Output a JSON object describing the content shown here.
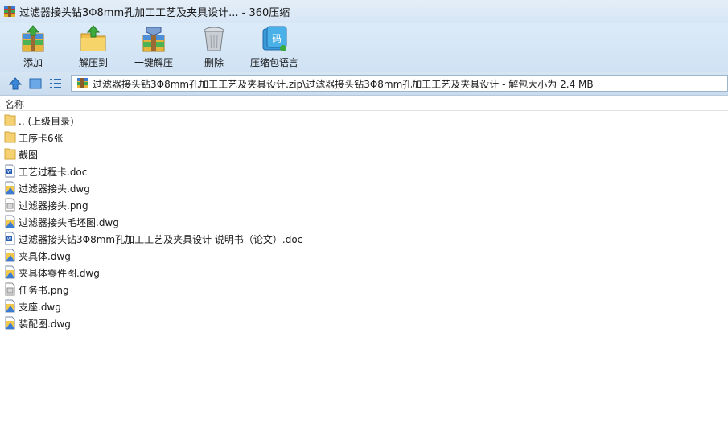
{
  "window": {
    "title": "过滤器接头钻3Φ8mm孔加工工艺及夹具设计... - 360压缩"
  },
  "toolbar": {
    "add": "添加",
    "extract_to": "解压到",
    "one_click_extract": "一键解压",
    "delete": "删除",
    "language": "压缩包语言"
  },
  "address": {
    "path": "过滤器接头钻3Φ8mm孔加工工艺及夹具设计.zip\\过滤器接头钻3Φ8mm孔加工工艺及夹具设计 - 解包大小为 2.4 MB"
  },
  "list": {
    "header": "名称",
    "items": [
      {
        "name": ".. (上级目录)",
        "type": "folder"
      },
      {
        "name": "工序卡6张",
        "type": "folder"
      },
      {
        "name": "截图",
        "type": "folder"
      },
      {
        "name": "工艺过程卡.doc",
        "type": "doc"
      },
      {
        "name": "过滤器接头.dwg",
        "type": "dwg"
      },
      {
        "name": "过滤器接头.png",
        "type": "png"
      },
      {
        "name": "过滤器接头毛坯图.dwg",
        "type": "dwg"
      },
      {
        "name": "过滤器接头钻3Φ8mm孔加工工艺及夹具设计 说明书（论文）.doc",
        "type": "doc"
      },
      {
        "name": "夹具体.dwg",
        "type": "dwg"
      },
      {
        "name": "夹具体零件图.dwg",
        "type": "dwg"
      },
      {
        "name": "任务书.png",
        "type": "png"
      },
      {
        "name": "支座.dwg",
        "type": "dwg"
      },
      {
        "name": "装配图.dwg",
        "type": "dwg"
      }
    ]
  }
}
